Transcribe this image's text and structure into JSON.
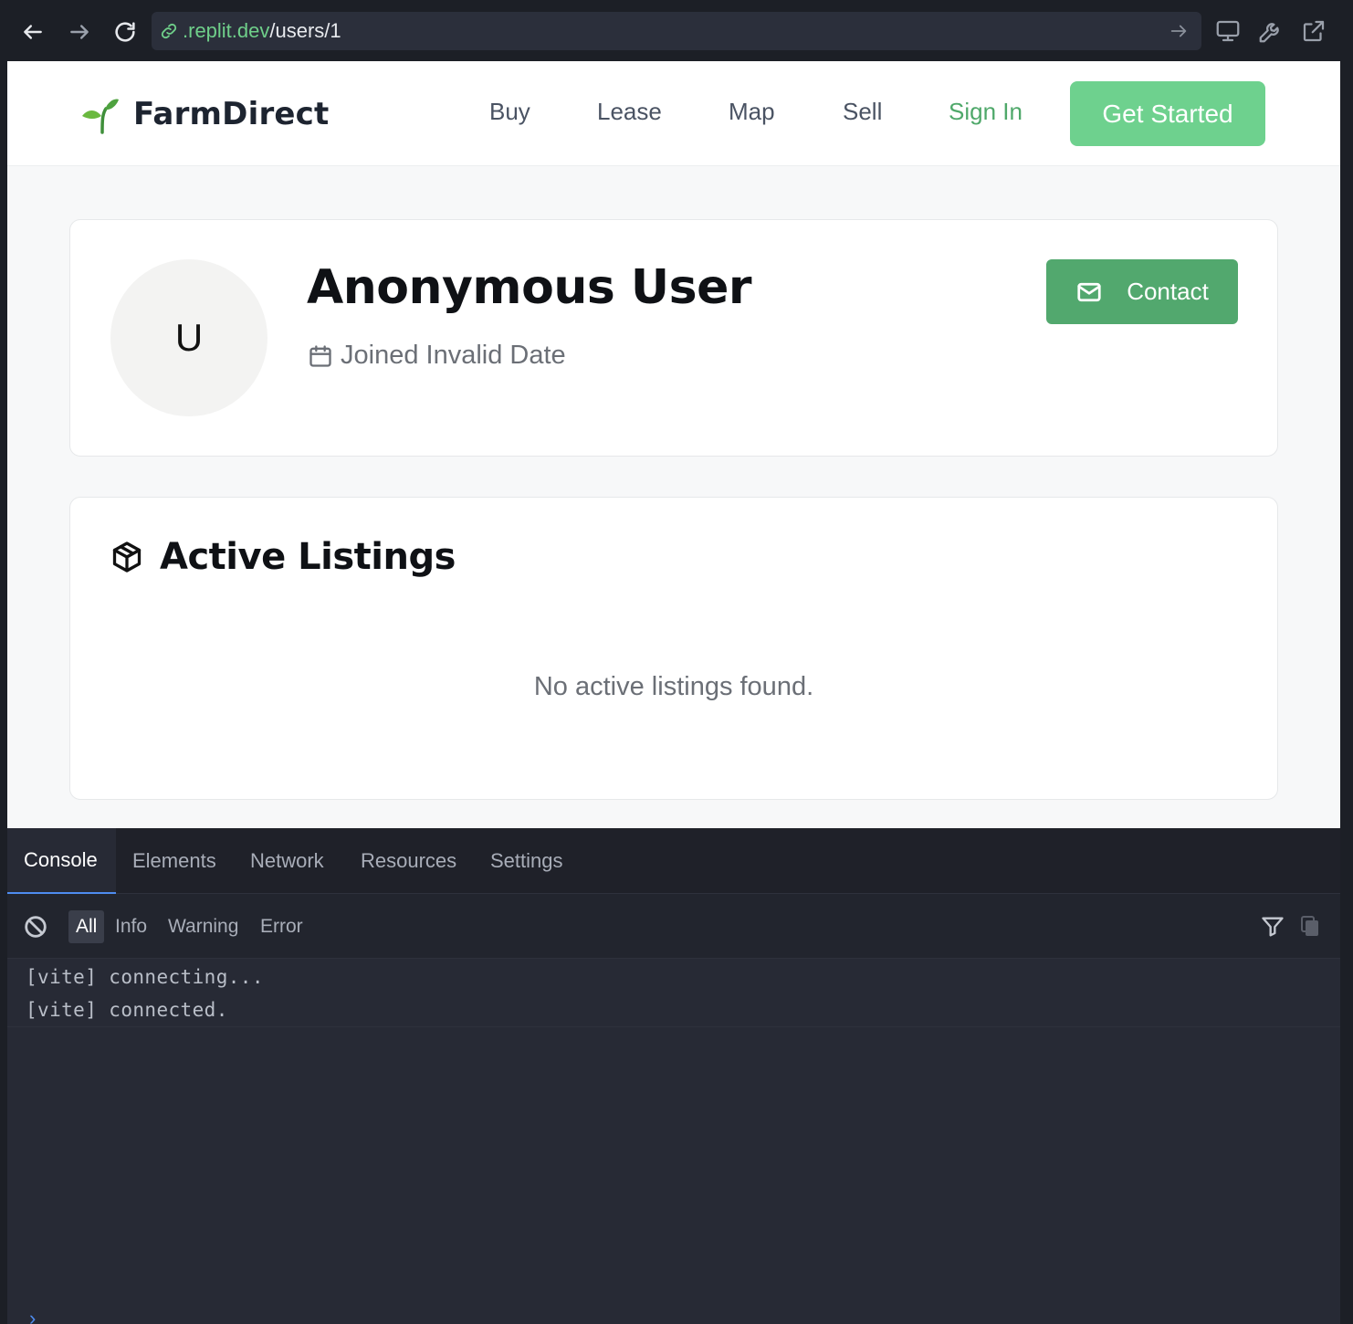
{
  "browser": {
    "url_host": ".replit.dev",
    "url_path": "/users/1",
    "icons": [
      "back-arrow-icon",
      "forward-arrow-icon",
      "reload-icon",
      "link-icon",
      "go-arrow-icon",
      "monitor-icon",
      "wrench-icon",
      "external-link-icon"
    ]
  },
  "site": {
    "brand": "FarmDirect",
    "nav": {
      "buy": "Buy",
      "lease": "Lease",
      "map": "Map",
      "sell": "Sell",
      "sign_in": "Sign In",
      "get_started": "Get Started"
    },
    "colors": {
      "accent": "#52a86e",
      "accent_light": "#6ed18e"
    }
  },
  "profile": {
    "avatar_initial": "U",
    "name": "Anonymous User",
    "joined": "Joined Invalid Date",
    "contact_label": "Contact"
  },
  "listings": {
    "title": "Active Listings",
    "empty_message": "No active listings found."
  },
  "devtools": {
    "tabs": {
      "console": "Console",
      "elements": "Elements",
      "network": "Network",
      "resources": "Resources",
      "settings": "Settings"
    },
    "filters": {
      "all": "All",
      "info": "Info",
      "warning": "Warning",
      "error": "Error"
    },
    "logs": [
      "[vite] connecting...",
      "[vite] connected."
    ]
  }
}
